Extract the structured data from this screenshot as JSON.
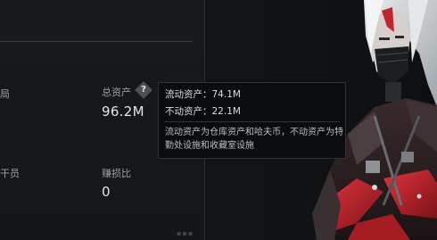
{
  "stats": {
    "partial_label_top": "局",
    "total_assets_label": "总资产",
    "total_assets_value": "96.2M",
    "partial_label_bottom": "干员",
    "profit_loss_label": "赚损比",
    "profit_loss_value": "0"
  },
  "help_icon": {
    "glyph": "?",
    "icon": "question-diamond-icon"
  },
  "tooltip": {
    "liquid_assets": "流动资产：74.1M",
    "fixed_assets": "不动资产：22.1M",
    "description": "流动资产为仓库资产和哈夫币，不动资产为特勤处设施和收藏室设施"
  },
  "colors": {
    "background": "#0e1112",
    "panel": "#161a1b",
    "tooltip_bg": "#0a0d0e",
    "accent_red": "#c0242c"
  }
}
